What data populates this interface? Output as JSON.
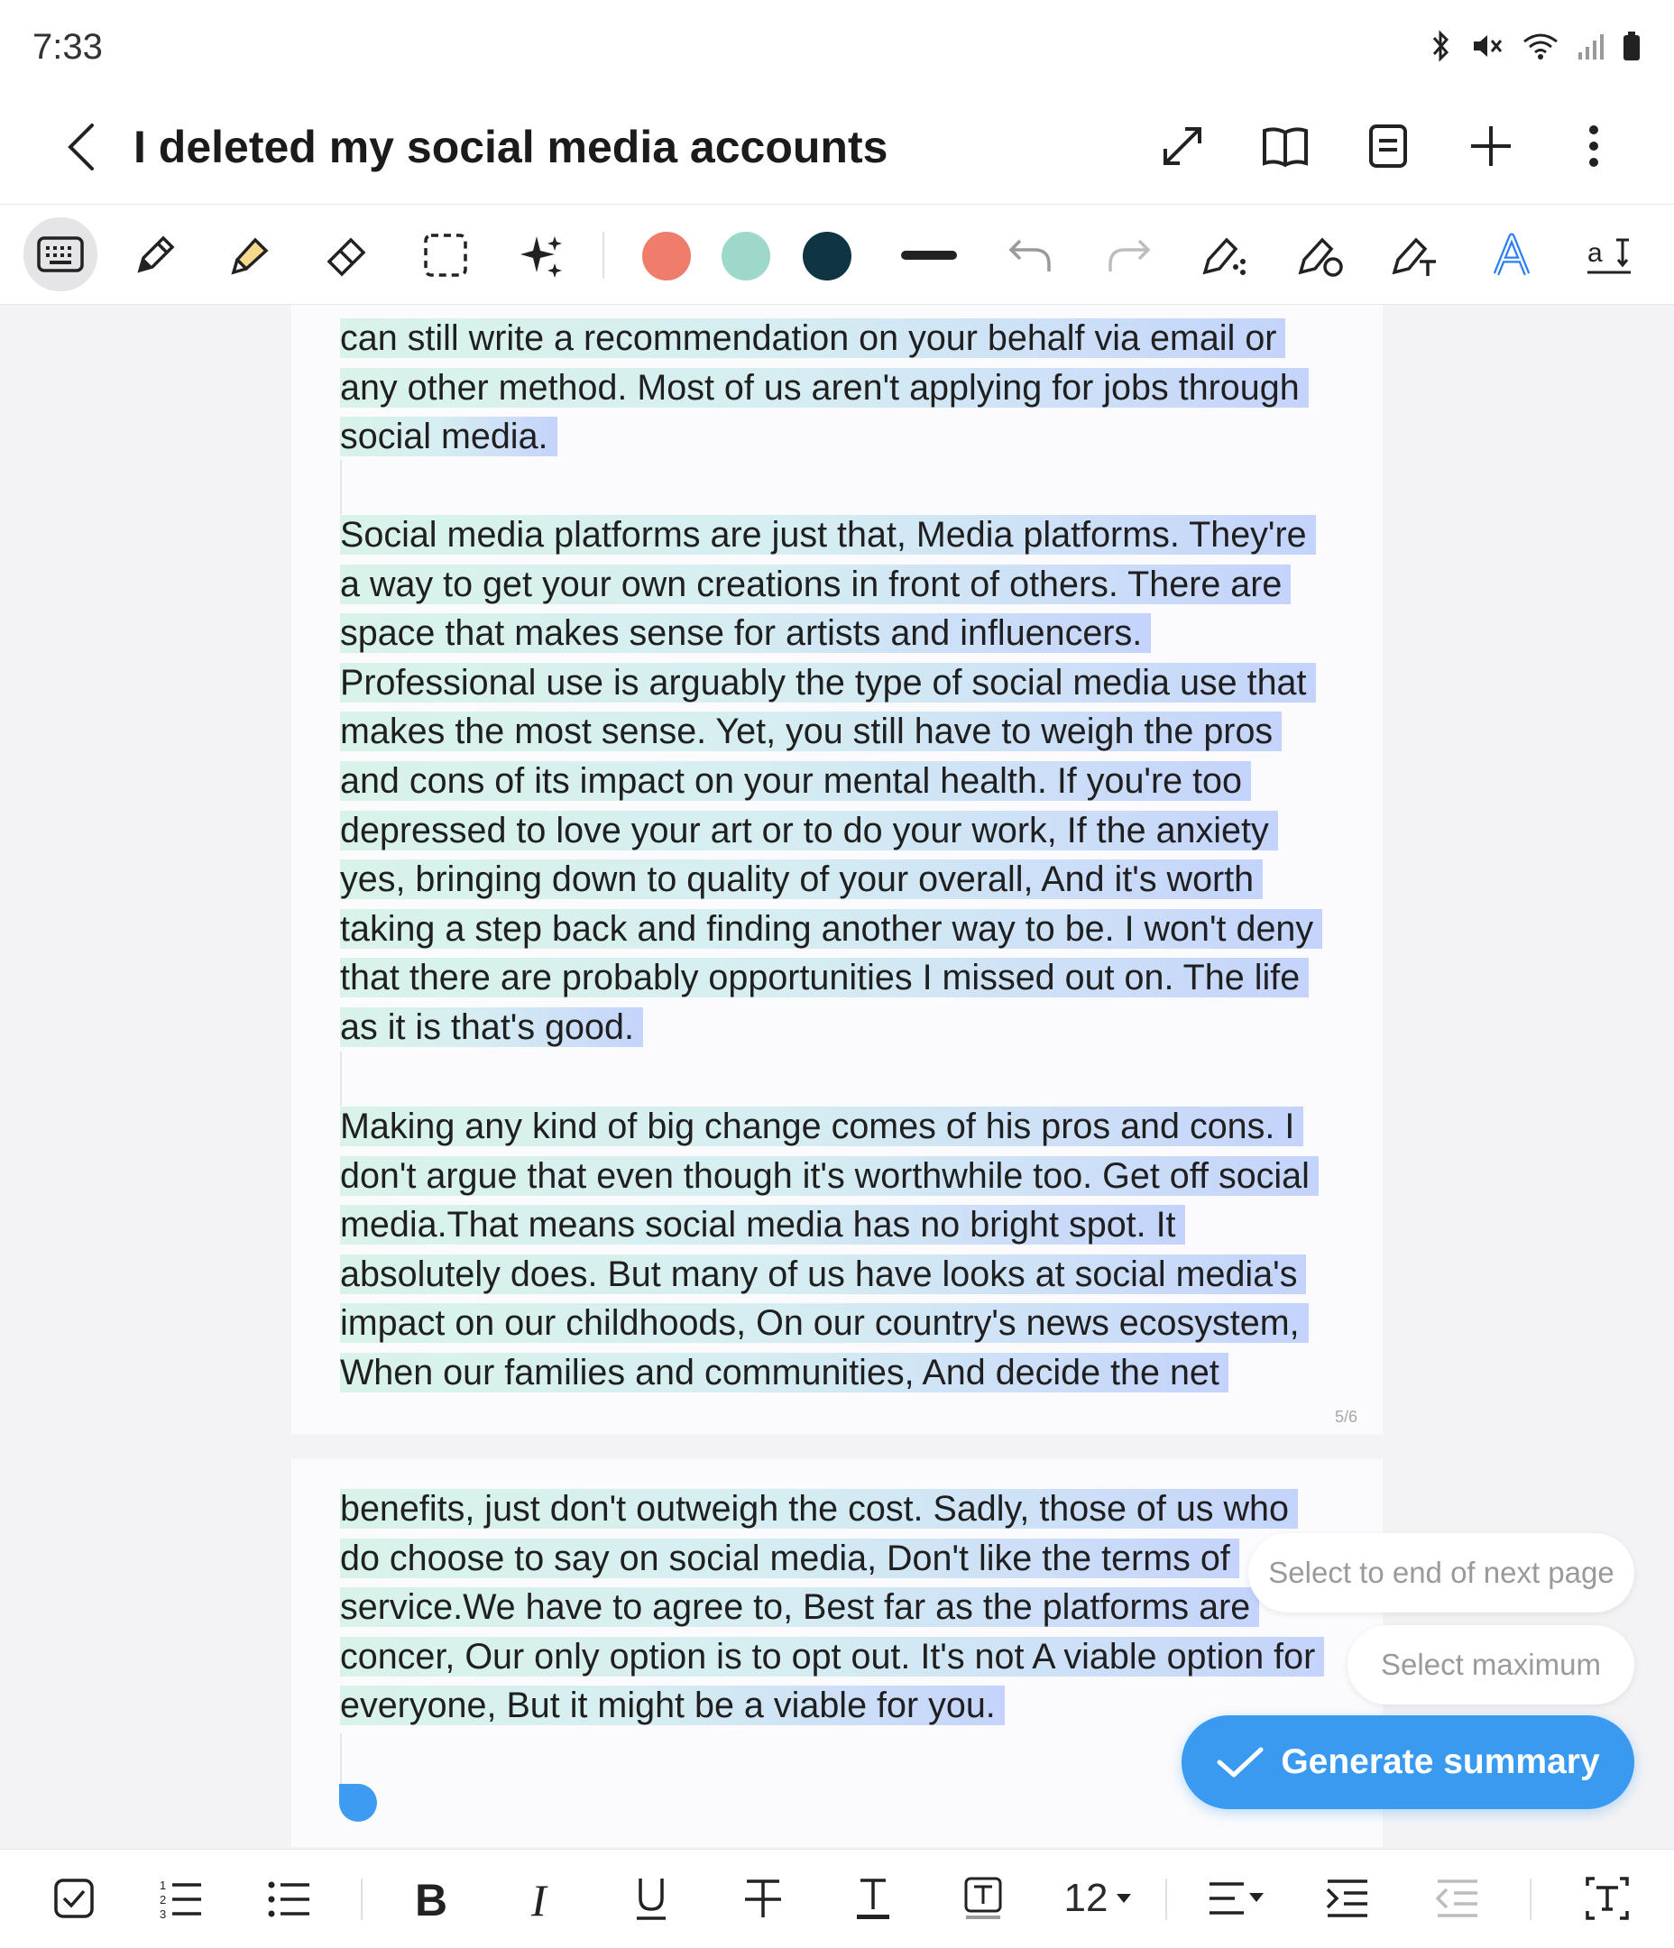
{
  "status_bar": {
    "time": "7:33",
    "icons": [
      "bluetooth-icon",
      "mute-icon",
      "wifi-icon",
      "signal-icon",
      "battery-icon"
    ]
  },
  "title_bar": {
    "title": "I deleted my social media accounts",
    "actions": [
      "expand-icon",
      "book-view-icon",
      "page-view-icon",
      "add-icon",
      "more-icon"
    ]
  },
  "pen_toolbar": {
    "tools": [
      "keyboard-icon",
      "pen-icon",
      "highlighter-icon",
      "eraser-icon",
      "lasso-select-icon",
      "sparkle-ai-icon"
    ],
    "colors": [
      "#f07d6c",
      "#9ed8ca",
      "#0f3442"
    ],
    "right_tools": [
      "undo-icon",
      "redo-icon",
      "shape-pen-icon",
      "shape-recognize-icon",
      "pen-to-text-icon",
      "handwriting-style-icon",
      "text-size-icon"
    ]
  },
  "page1": {
    "paragraphs": [
      "can still write a recommendation on your behalf via email or any other method. Most of us aren't applying for jobs through social media.",
      "Social media platforms are just that, Media platforms. They're a way to get your own creations in front of others. There are space that makes sense for artists and influencers. Professional use is arguably the type of social media use that makes the most sense. Yet, you still have to weigh the pros and cons of its impact on your mental health. If you're too depressed to love your art or to do your work, If the anxiety yes, bringing down to quality of your overall, And it's worth taking a step back and finding another way to be. I won't deny that there are probably opportunities I missed out on. The life as it is that's good.",
      "Making any kind of big change comes of his pros and cons. I don't argue that even though it's worthwhile too. Get off social media.That means social media has no bright spot. It absolutely does. But many of us have looks at social media's impact on our childhoods, On our country's news ecosystem, When our families and communities, And decide the net"
    ],
    "page_number": "5/6"
  },
  "page2": {
    "paragraphs": [
      "benefits, just don't outweigh the cost. Sadly, those of us who do choose to say on social media, Don't like the terms of service.We have to agree to, Best far as the platforms are concer, Our only option is to opt out. It's not A viable option for everyone, But it might be a viable for you."
    ]
  },
  "floating_actions": {
    "select_next_page": "Select to end of next page",
    "select_maximum": "Select maximum",
    "generate_summary": "Generate summary"
  },
  "format_toolbar": {
    "font_size": "12",
    "tools": [
      "checkbox-icon",
      "numbered-list-icon",
      "bullet-list-icon",
      "bold-icon",
      "italic-icon",
      "underline-icon",
      "strikethrough-icon",
      "text-color-icon",
      "text-background-icon",
      "align-icon",
      "indent-icon",
      "outdent-icon",
      "text-box-icon"
    ]
  }
}
